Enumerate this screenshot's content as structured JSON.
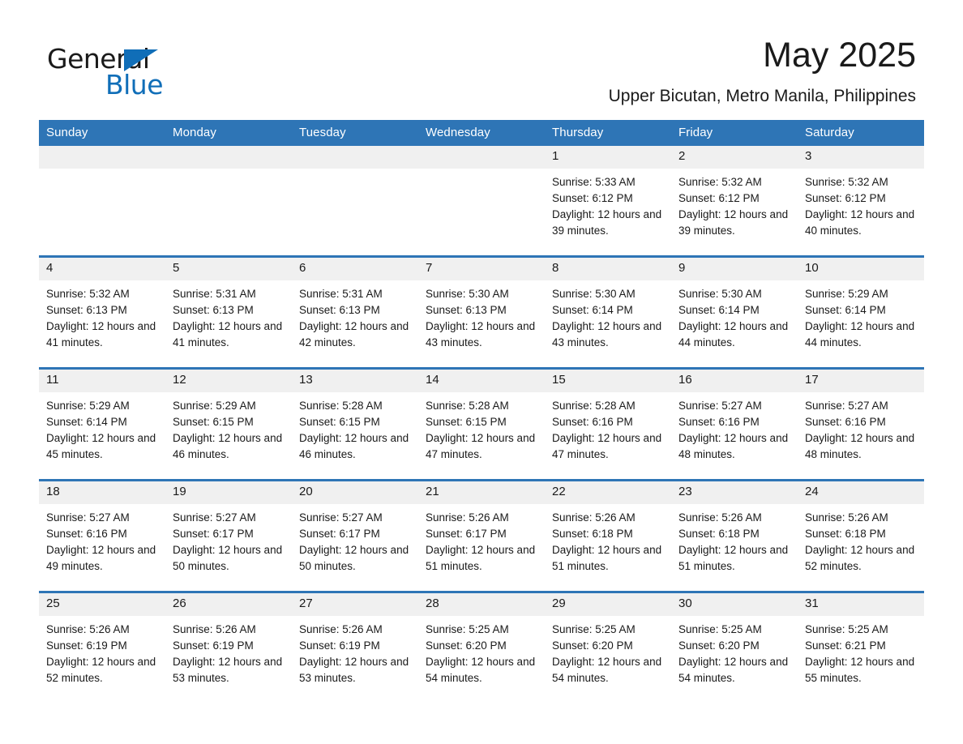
{
  "logo": {
    "word_one": "General",
    "word_two": "Blue",
    "triangle": "blue-triangle-icon",
    "accent_color": "#106eb8"
  },
  "header": {
    "month_title": "May 2025",
    "location": "Upper Bicutan, Metro Manila, Philippines"
  },
  "theme": {
    "header_blue": "#2e75b6",
    "daynum_gray": "#f0f0f0",
    "text": "#1a1a1a"
  },
  "calendar": {
    "weekday_headers": [
      "Sunday",
      "Monday",
      "Tuesday",
      "Wednesday",
      "Thursday",
      "Friday",
      "Saturday"
    ],
    "labels": {
      "sunrise": "Sunrise:",
      "sunset": "Sunset:",
      "daylight": "Daylight:"
    },
    "weeks": [
      [
        {
          "day": "",
          "sunrise": "",
          "sunset": "",
          "daylight": ""
        },
        {
          "day": "",
          "sunrise": "",
          "sunset": "",
          "daylight": ""
        },
        {
          "day": "",
          "sunrise": "",
          "sunset": "",
          "daylight": ""
        },
        {
          "day": "",
          "sunrise": "",
          "sunset": "",
          "daylight": ""
        },
        {
          "day": "1",
          "sunrise": "Sunrise: 5:33 AM",
          "sunset": "Sunset: 6:12 PM",
          "daylight": "Daylight: 12 hours and 39 minutes."
        },
        {
          "day": "2",
          "sunrise": "Sunrise: 5:32 AM",
          "sunset": "Sunset: 6:12 PM",
          "daylight": "Daylight: 12 hours and 39 minutes."
        },
        {
          "day": "3",
          "sunrise": "Sunrise: 5:32 AM",
          "sunset": "Sunset: 6:12 PM",
          "daylight": "Daylight: 12 hours and 40 minutes."
        }
      ],
      [
        {
          "day": "4",
          "sunrise": "Sunrise: 5:32 AM",
          "sunset": "Sunset: 6:13 PM",
          "daylight": "Daylight: 12 hours and 41 minutes."
        },
        {
          "day": "5",
          "sunrise": "Sunrise: 5:31 AM",
          "sunset": "Sunset: 6:13 PM",
          "daylight": "Daylight: 12 hours and 41 minutes."
        },
        {
          "day": "6",
          "sunrise": "Sunrise: 5:31 AM",
          "sunset": "Sunset: 6:13 PM",
          "daylight": "Daylight: 12 hours and 42 minutes."
        },
        {
          "day": "7",
          "sunrise": "Sunrise: 5:30 AM",
          "sunset": "Sunset: 6:13 PM",
          "daylight": "Daylight: 12 hours and 43 minutes."
        },
        {
          "day": "8",
          "sunrise": "Sunrise: 5:30 AM",
          "sunset": "Sunset: 6:14 PM",
          "daylight": "Daylight: 12 hours and 43 minutes."
        },
        {
          "day": "9",
          "sunrise": "Sunrise: 5:30 AM",
          "sunset": "Sunset: 6:14 PM",
          "daylight": "Daylight: 12 hours and 44 minutes."
        },
        {
          "day": "10",
          "sunrise": "Sunrise: 5:29 AM",
          "sunset": "Sunset: 6:14 PM",
          "daylight": "Daylight: 12 hours and 44 minutes."
        }
      ],
      [
        {
          "day": "11",
          "sunrise": "Sunrise: 5:29 AM",
          "sunset": "Sunset: 6:14 PM",
          "daylight": "Daylight: 12 hours and 45 minutes."
        },
        {
          "day": "12",
          "sunrise": "Sunrise: 5:29 AM",
          "sunset": "Sunset: 6:15 PM",
          "daylight": "Daylight: 12 hours and 46 minutes."
        },
        {
          "day": "13",
          "sunrise": "Sunrise: 5:28 AM",
          "sunset": "Sunset: 6:15 PM",
          "daylight": "Daylight: 12 hours and 46 minutes."
        },
        {
          "day": "14",
          "sunrise": "Sunrise: 5:28 AM",
          "sunset": "Sunset: 6:15 PM",
          "daylight": "Daylight: 12 hours and 47 minutes."
        },
        {
          "day": "15",
          "sunrise": "Sunrise: 5:28 AM",
          "sunset": "Sunset: 6:16 PM",
          "daylight": "Daylight: 12 hours and 47 minutes."
        },
        {
          "day": "16",
          "sunrise": "Sunrise: 5:27 AM",
          "sunset": "Sunset: 6:16 PM",
          "daylight": "Daylight: 12 hours and 48 minutes."
        },
        {
          "day": "17",
          "sunrise": "Sunrise: 5:27 AM",
          "sunset": "Sunset: 6:16 PM",
          "daylight": "Daylight: 12 hours and 48 minutes."
        }
      ],
      [
        {
          "day": "18",
          "sunrise": "Sunrise: 5:27 AM",
          "sunset": "Sunset: 6:16 PM",
          "daylight": "Daylight: 12 hours and 49 minutes."
        },
        {
          "day": "19",
          "sunrise": "Sunrise: 5:27 AM",
          "sunset": "Sunset: 6:17 PM",
          "daylight": "Daylight: 12 hours and 50 minutes."
        },
        {
          "day": "20",
          "sunrise": "Sunrise: 5:27 AM",
          "sunset": "Sunset: 6:17 PM",
          "daylight": "Daylight: 12 hours and 50 minutes."
        },
        {
          "day": "21",
          "sunrise": "Sunrise: 5:26 AM",
          "sunset": "Sunset: 6:17 PM",
          "daylight": "Daylight: 12 hours and 51 minutes."
        },
        {
          "day": "22",
          "sunrise": "Sunrise: 5:26 AM",
          "sunset": "Sunset: 6:18 PM",
          "daylight": "Daylight: 12 hours and 51 minutes."
        },
        {
          "day": "23",
          "sunrise": "Sunrise: 5:26 AM",
          "sunset": "Sunset: 6:18 PM",
          "daylight": "Daylight: 12 hours and 51 minutes."
        },
        {
          "day": "24",
          "sunrise": "Sunrise: 5:26 AM",
          "sunset": "Sunset: 6:18 PM",
          "daylight": "Daylight: 12 hours and 52 minutes."
        }
      ],
      [
        {
          "day": "25",
          "sunrise": "Sunrise: 5:26 AM",
          "sunset": "Sunset: 6:19 PM",
          "daylight": "Daylight: 12 hours and 52 minutes."
        },
        {
          "day": "26",
          "sunrise": "Sunrise: 5:26 AM",
          "sunset": "Sunset: 6:19 PM",
          "daylight": "Daylight: 12 hours and 53 minutes."
        },
        {
          "day": "27",
          "sunrise": "Sunrise: 5:26 AM",
          "sunset": "Sunset: 6:19 PM",
          "daylight": "Daylight: 12 hours and 53 minutes."
        },
        {
          "day": "28",
          "sunrise": "Sunrise: 5:25 AM",
          "sunset": "Sunset: 6:20 PM",
          "daylight": "Daylight: 12 hours and 54 minutes."
        },
        {
          "day": "29",
          "sunrise": "Sunrise: 5:25 AM",
          "sunset": "Sunset: 6:20 PM",
          "daylight": "Daylight: 12 hours and 54 minutes."
        },
        {
          "day": "30",
          "sunrise": "Sunrise: 5:25 AM",
          "sunset": "Sunset: 6:20 PM",
          "daylight": "Daylight: 12 hours and 54 minutes."
        },
        {
          "day": "31",
          "sunrise": "Sunrise: 5:25 AM",
          "sunset": "Sunset: 6:21 PM",
          "daylight": "Daylight: 12 hours and 55 minutes."
        }
      ]
    ]
  }
}
